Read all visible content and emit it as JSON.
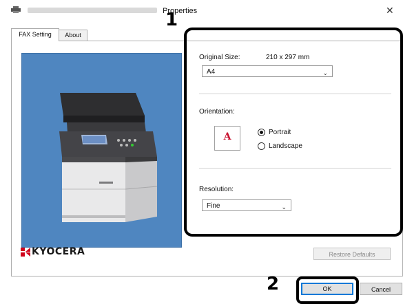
{
  "window": {
    "title": "Properties"
  },
  "callouts": {
    "first": "1",
    "second": "2"
  },
  "tabs": [
    {
      "label": "FAX Setting"
    },
    {
      "label": "About"
    }
  ],
  "logo": {
    "text": "KYOCERA"
  },
  "settings": {
    "original_size": {
      "label": "Original Size:",
      "dimension": "210 x 297 mm",
      "value": "A4"
    },
    "orientation": {
      "label": "Orientation:",
      "icon_letter": "A",
      "options": [
        "Portrait",
        "Landscape"
      ],
      "selected": "Portrait"
    },
    "resolution": {
      "label": "Resolution:",
      "value": "Fine"
    }
  },
  "buttons": {
    "restore_defaults": "Restore Defaults",
    "ok": "OK",
    "cancel": "Cancel"
  },
  "icons": [
    "printer-icon",
    "close-icon",
    "chevron-down-icon",
    "kyocera-logo-icon"
  ],
  "colors": {
    "image_bg": "#4f86c0",
    "focus_blue": "#0078d7",
    "logo_red": "#d0021b"
  }
}
